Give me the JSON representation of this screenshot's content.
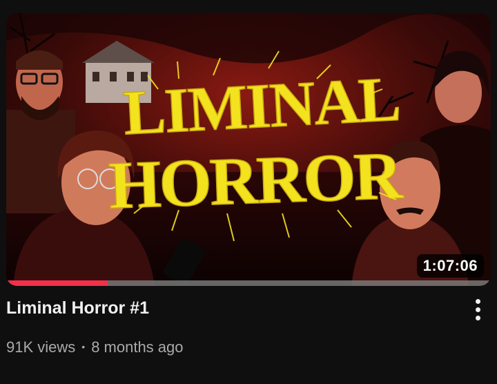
{
  "video": {
    "title": "Liminal Horror #1",
    "duration": "1:07:06",
    "views": "91K views",
    "separator": "•",
    "age": "8 months ago",
    "watch_progress": 0.21,
    "thumbnail_text": [
      "LIMINAL",
      "HORROR"
    ]
  },
  "menu": {
    "icon": "more-vert-icon"
  },
  "colors": {
    "background": "#0f0f0f",
    "progress": "#f2304a",
    "logo": "#f3e21e",
    "meta_text": "#aaaaaa"
  }
}
